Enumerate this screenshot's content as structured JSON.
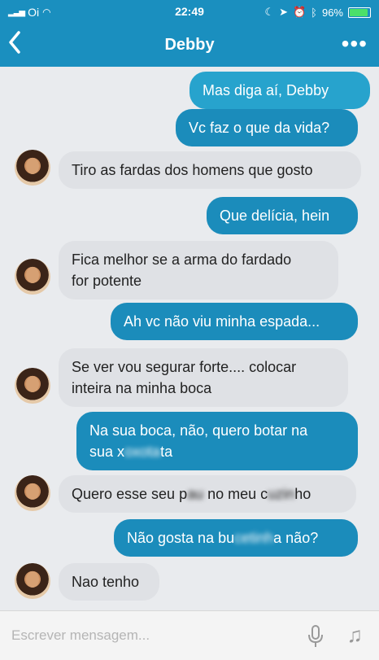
{
  "status": {
    "carrier": "Oi",
    "time": "22:49",
    "battery": "96%"
  },
  "header": {
    "back_icon": "‹",
    "title": "Debby",
    "more_icon": "•••"
  },
  "messages": [
    {
      "from": "me",
      "text": "Mas diga aí, Debby"
    },
    {
      "from": "me",
      "text": "Vc faz o que da vida?"
    },
    {
      "from": "debby",
      "text": "Tiro as fardas dos homens que gosto"
    },
    {
      "from": "me",
      "text": "Que delícia, hein"
    },
    {
      "from": "debby",
      "line1": "Fica melhor se a arma do fardado",
      "line2": "for potente"
    },
    {
      "from": "me",
      "text": "Ah vc não viu minha espada..."
    },
    {
      "from": "debby",
      "line1": "Se ver vou segurar forte.... colocar",
      "line2": "inteira na minha boca"
    },
    {
      "from": "me",
      "line1": "Na sua boca, não, quero  botar na",
      "line2a": "sua x",
      "line2_blur": "oxota",
      "line2b": "ta"
    },
    {
      "from": "debby",
      "p1": "Quero esse seu p",
      "b1": "au",
      "p2": " no meu c",
      "b2": "uzin",
      "p3": "ho"
    },
    {
      "from": "me",
      "p1": "Não gosta na bu",
      "b1": "cetinh",
      "p2": "a não?"
    },
    {
      "from": "debby",
      "text": "Nao tenho"
    }
  ],
  "composer": {
    "placeholder": "Escrever mensagem...",
    "mic_icon": "microphone-icon",
    "music_icon": "music-note-icon"
  }
}
